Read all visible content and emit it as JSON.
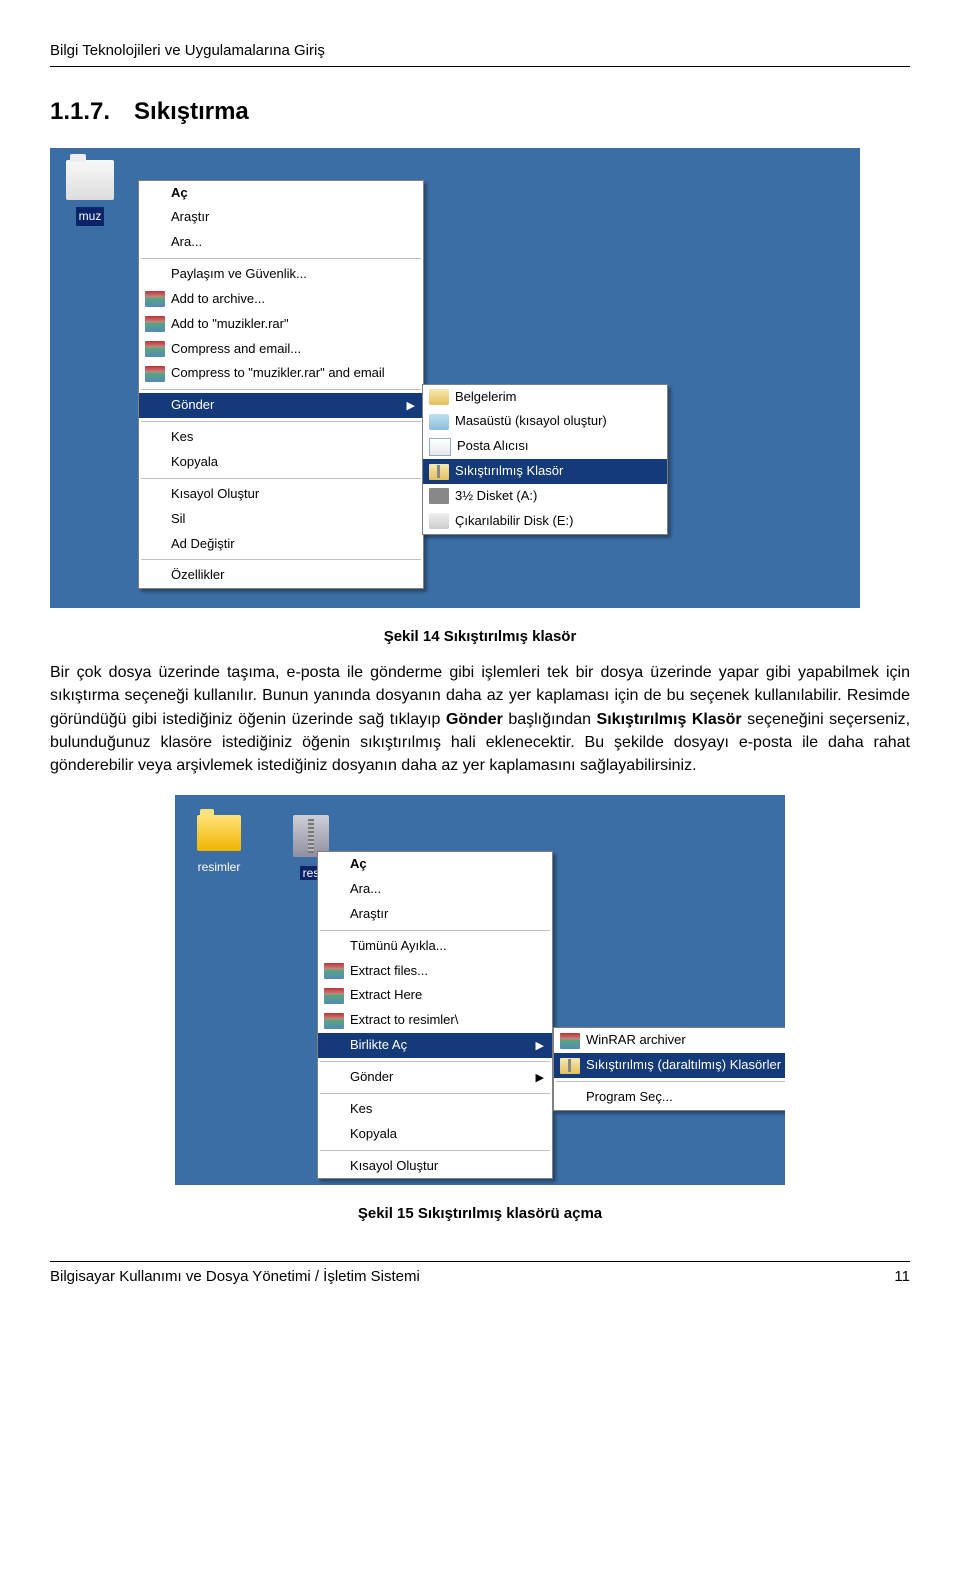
{
  "header": "Bilgi Teknolojileri ve Uygulamalarına Giriş",
  "section": {
    "number": "1.1.7.",
    "title": "Sıkıştırma"
  },
  "fig14": {
    "folder_label": "muz",
    "menu": {
      "open": "Aç",
      "explore": "Araştır",
      "search": "Ara...",
      "sharing": "Paylaşım ve Güvenlik...",
      "add_archive": "Add to archive...",
      "add_muzikler": "Add to \"muzikler.rar\"",
      "compress_email": "Compress and email...",
      "compress_muzikler_email": "Compress to \"muzikler.rar\" and email",
      "send": "Gönder",
      "cut": "Kes",
      "copy": "Kopyala",
      "shortcut": "Kısayol Oluştur",
      "delete": "Sil",
      "rename": "Ad Değiştir",
      "properties": "Özellikler"
    },
    "submenu": {
      "mydocs": "Belgelerim",
      "desktop_shortcut": "Masaüstü (kısayol oluştur)",
      "mail_recipient": "Posta Alıcısı",
      "compressed_folder": "Sıkıştırılmış Klasör",
      "floppy": "3½ Disket (A:)",
      "removable": "Çıkarılabilir Disk (E:)"
    },
    "caption": "Şekil 14 Sıkıştırılmış klasör"
  },
  "paragraph": "Bir çok dosya üzerinde taşıma, e-posta ile gönderme gibi işlemleri tek bir dosya üzerinde yapar gibi yapabilmek için sıkıştırma seçeneği kullanılır. Bunun yanında dosyanın daha az yer kaplaması için de bu seçenek kullanılabilir. Resimde göründüğü gibi istediğiniz öğenin üzerinde sağ tıklayıp Gönder başlığından Sıkıştırılmış Klasör seçeneğini seçerseniz, bulunduğunuz klasöre istediğiniz öğenin sıkıştırılmış hali eklenecektir. Bu şekilde dosyayı e-posta ile daha rahat gönderebilir veya arşivlemek istediğiniz dosyanın daha az yer kaplamasını sağlayabilirsiniz.",
  "fig15": {
    "icon_resimler": "resimler",
    "icon_res": "res",
    "menu": {
      "open": "Aç",
      "search": "Ara...",
      "explore": "Araştır",
      "extract_all": "Tümünü Ayıkla...",
      "extract_files": "Extract files...",
      "extract_here": "Extract Here",
      "extract_to": "Extract to resimler\\",
      "open_with": "Birlikte Aç",
      "send": "Gönder",
      "cut": "Kes",
      "copy": "Kopyala",
      "shortcut": "Kısayol Oluştur"
    },
    "submenu": {
      "winrar": "WinRAR archiver",
      "compressed_folders": "Sıkıştırılmış (daraltılmış) Klasörler",
      "choose_program": "Program Seç..."
    },
    "caption": "Şekil 15 Sıkıştırılmış klasörü açma"
  },
  "footer": {
    "left": "Bilgisayar Kullanımı ve Dosya Yönetimi / İşletim Sistemi",
    "page": "11"
  }
}
